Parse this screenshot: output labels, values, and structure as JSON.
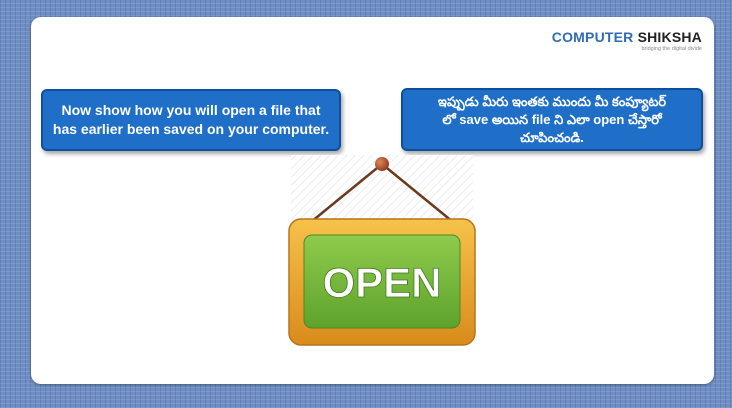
{
  "logo": {
    "primary": "COMPUTER",
    "secondary": "SHIKSHA",
    "tagline": "bridging the digital divide"
  },
  "callouts": {
    "english": {
      "line1": "Now show how you will open a file that",
      "line2": "has earlier been saved on your computer."
    },
    "telugu": {
      "line1": "ఇప్పుడు మీరు ఇంతకు ముందు మీ కంప్యూటర్",
      "line2": "లో save అయిన file ని ఎలా open చేస్తారో",
      "line3": "చూపించండి."
    }
  },
  "sign": {
    "text": "OPEN"
  },
  "colors": {
    "background": "#6f8fc4",
    "callout": "#1f6fc9",
    "sign_frame": "#e8a62a",
    "sign_panel": "#7cbb3e"
  }
}
